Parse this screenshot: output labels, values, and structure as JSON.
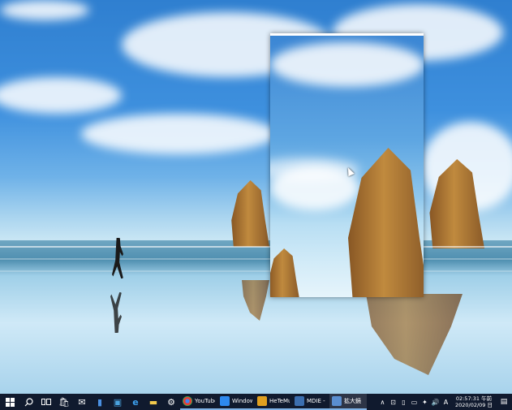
{
  "desktop": {
    "wallpaper": "beach-runner-rock-formation",
    "magnifier_window": {
      "title": "拡大鏡",
      "cursor_icon": "arrow-cursor"
    }
  },
  "taskbar": {
    "start_icon": "windows-logo",
    "search_icon": "search-icon",
    "taskview_icon": "task-view-icon",
    "pinned": [
      {
        "name": "store",
        "glyph": "🛍"
      },
      {
        "name": "mail",
        "glyph": "✉"
      },
      {
        "name": "document",
        "glyph": "▮"
      },
      {
        "name": "photos",
        "glyph": "▣"
      },
      {
        "name": "edge",
        "glyph": "e"
      },
      {
        "name": "explorer",
        "glyph": "▬"
      },
      {
        "name": "settings",
        "glyph": "⚙"
      }
    ],
    "apps": [
      {
        "label": "YouTube ...",
        "icon": "chrome-icon",
        "color": "#e44134"
      },
      {
        "label": "Windows...",
        "icon": "windows-app-icon",
        "color": "#2d89ef"
      },
      {
        "label": "HeTeMu...",
        "icon": "hetemu-icon",
        "color": "#e0a020"
      },
      {
        "label": "MDIE - [...",
        "icon": "mdie-icon",
        "color": "#3c6fb0"
      },
      {
        "label": "拡大鏡",
        "icon": "magnifier-icon",
        "color": "#5a8ed0"
      }
    ],
    "tray": {
      "chevron": "∧",
      "icons": [
        "⊡",
        "▯",
        "▭",
        "✦",
        "🔊"
      ],
      "ime": "A",
      "time": "02:57:31 午前",
      "date": "2020/02/09 日",
      "notification_glyph": "▤"
    }
  }
}
